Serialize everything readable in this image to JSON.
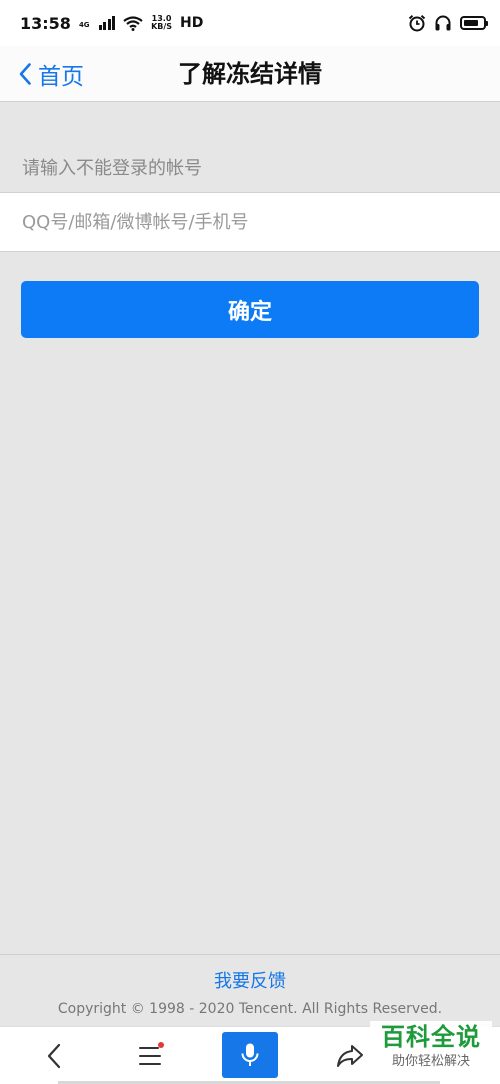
{
  "status_bar": {
    "time": "13:58",
    "network": "4G",
    "speed_value": "13.0",
    "speed_unit": "KB/S",
    "hd": "HD",
    "battery_level": 0.8
  },
  "nav": {
    "back_label": "首页",
    "title": "了解冻结详情"
  },
  "form": {
    "prompt": "请输入不能登录的帐号",
    "account_placeholder": "QQ号/邮箱/微博帐号/手机号",
    "account_value": "",
    "confirm_label": "确定"
  },
  "footer": {
    "feedback_label": "我要反馈",
    "copyright": "Copyright © 1998 - 2020 Tencent. All Rights Reserved."
  },
  "bottom_bar": {
    "icons": [
      "back-arrow-icon",
      "menu-icon",
      "microphone-icon",
      "share-icon"
    ]
  },
  "watermark": {
    "title": "百科全说",
    "subtitle": "助你轻松解决"
  },
  "colors": {
    "accent": "#1677e8",
    "button": "#0c7bf5",
    "background": "#e6e6e6",
    "watermark_green": "#1d9a3a",
    "notification_dot": "#e53935"
  }
}
